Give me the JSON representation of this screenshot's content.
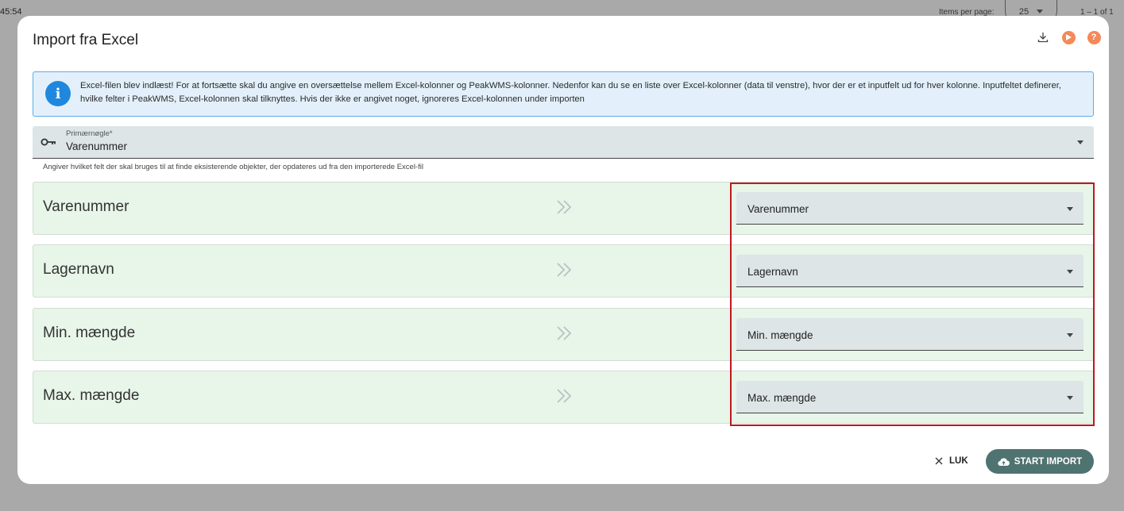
{
  "background": {
    "time": "45:54",
    "items_per_page_label": "Items per page:",
    "items_per_page_value": "25",
    "range": "1 – 1 of 1"
  },
  "dialog": {
    "title": "Import fra Excel",
    "header_icons": [
      "download-icon",
      "play-icon",
      "help-icon"
    ],
    "help_glyph": "?",
    "info": {
      "text": "Excel-filen blev indlæst! For at fortsætte skal du angive en oversættelse mellem Excel-kolonner og PeakWMS-kolonner. Nedenfor kan du se en liste over Excel-kolonner (data til venstre), hvor der er et inputfelt ud for hver kolonne. Inputfeltet definerer, hvilke felter i PeakWMS, Excel-kolonnen skal tilknyttes. Hvis der ikke er angivet noget, ignoreres Excel-kolonnen under importen"
    },
    "primary_key": {
      "label": "Primærnøgle*",
      "value": "Varenummer",
      "hint": "Angiver hvilket felt der skal bruges til at finde eksisterende objekter, der opdateres ud fra den importerede Excel-fil"
    },
    "mappings": [
      {
        "excel_column": "Varenummer",
        "field": "Varenummer"
      },
      {
        "excel_column": "Lagernavn",
        "field": "Lagernavn"
      },
      {
        "excel_column": "Min. mængde",
        "field": "Min. mængde"
      },
      {
        "excel_column": "Max. mængde",
        "field": "Max. mængde"
      }
    ],
    "actions": {
      "close_label": "LUK",
      "start_label": "START IMPORT"
    }
  },
  "colors": {
    "accent": "#4f7370",
    "info_blue": "#1f88de",
    "highlight": "#c0181f",
    "row_bg": "#e8f5e9",
    "orange_icon": "#f4895a"
  }
}
